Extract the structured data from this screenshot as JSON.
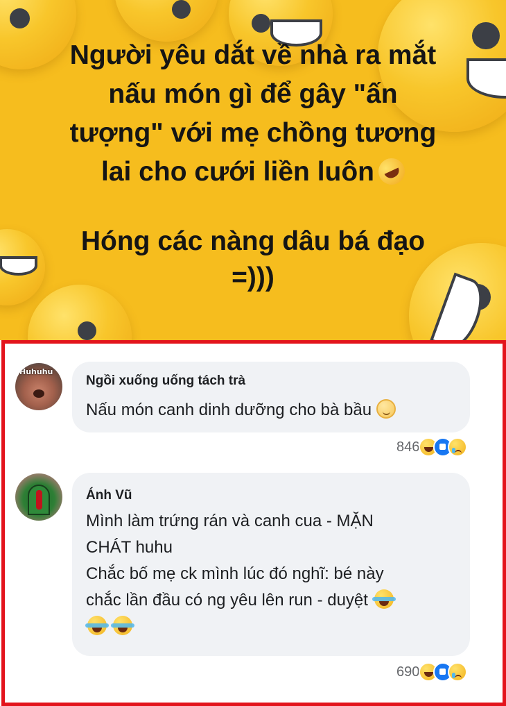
{
  "post": {
    "headline_lines": [
      "Người yêu dắt về nhà ra mắt",
      "nấu món gì để gây \"ấn",
      "tượng\" với mẹ chồng tương",
      "lai cho cưới liền luôn"
    ],
    "subline_lines": [
      "Hóng các nàng dâu bá đạo",
      "=)))"
    ],
    "headline_emoji": "rolling-on-floor-laughing"
  },
  "comments": [
    {
      "author": "Ngồi xuống uống tách trà",
      "avatar_caption": "Huhuhu",
      "lines": [
        "Nấu món canh dinh dưỡng cho bà bầu"
      ],
      "emoji": "relieved-face",
      "reaction_count": "846",
      "reactions": [
        "haha",
        "like",
        "sad"
      ]
    },
    {
      "author": "Ánh Vũ",
      "lines": [
        "Mình làm trứng rán và canh cua - MẶN",
        "CHÁT huhu",
        "Chắc bố mẹ ck mình lúc đó nghĩ: bé này",
        "chắc lần đầu có ng yêu lên run - duyệt"
      ],
      "emoji": "face-with-tears-of-joy",
      "reaction_count": "690",
      "reactions": [
        "haha",
        "like",
        "sad"
      ]
    }
  ],
  "colors": {
    "banner_bg": "#f6bd1e",
    "highlight_border": "#e3141c",
    "bubble_bg": "#f0f2f5",
    "text": "#1c1e21",
    "muted": "#65676b",
    "like_blue": "#1877f2"
  }
}
